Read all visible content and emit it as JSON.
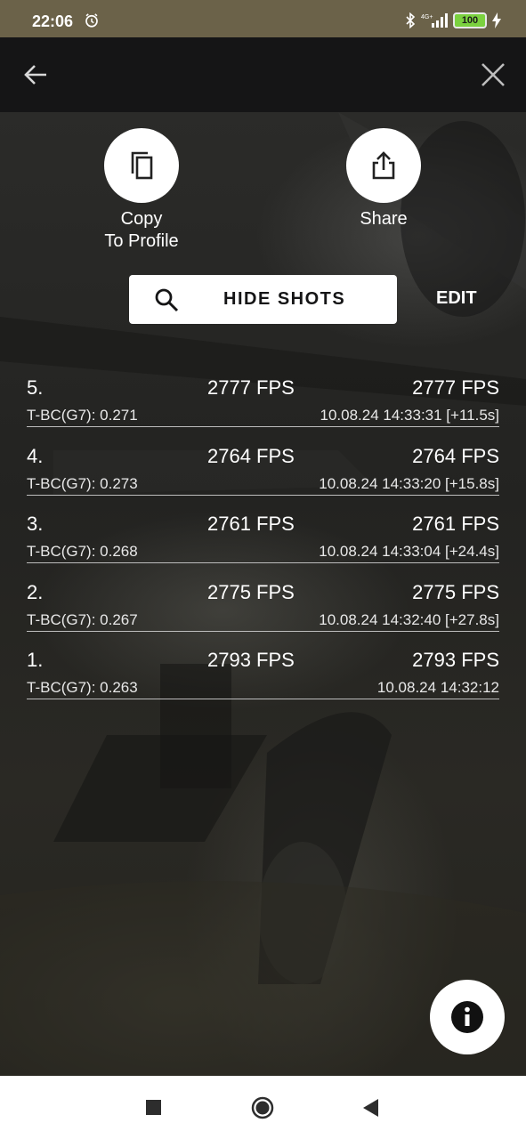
{
  "status_bar": {
    "time": "22:06",
    "battery": "100",
    "icons": [
      "alarm-icon",
      "bluetooth-icon",
      "signal-icon",
      "battery-icon",
      "charging-icon"
    ]
  },
  "app_bar": {
    "back_icon": "back-arrow-icon",
    "close_icon": "close-icon"
  },
  "actions": {
    "copy": {
      "line1": "Copy",
      "line2": "To Profile",
      "icon": "copy-icon"
    },
    "share": {
      "label": "Share",
      "icon": "share-icon"
    }
  },
  "controls": {
    "hide_shots": "HIDE SHOTS",
    "edit": "EDIT"
  },
  "shots": [
    {
      "num": "5.",
      "speed_mid": "2777 FPS",
      "speed_right": "2777 FPS",
      "bc": "T-BC(G7): 0.271",
      "time": "10.08.24 14:33:31 [+11.5s]"
    },
    {
      "num": "4.",
      "speed_mid": "2764 FPS",
      "speed_right": "2764 FPS",
      "bc": "T-BC(G7): 0.273",
      "time": "10.08.24 14:33:20 [+15.8s]"
    },
    {
      "num": "3.",
      "speed_mid": "2761 FPS",
      "speed_right": "2761 FPS",
      "bc": "T-BC(G7): 0.268",
      "time": "10.08.24 14:33:04 [+24.4s]"
    },
    {
      "num": "2.",
      "speed_mid": "2775 FPS",
      "speed_right": "2775 FPS",
      "bc": "T-BC(G7): 0.267",
      "time": "10.08.24 14:32:40 [+27.8s]"
    },
    {
      "num": "1.",
      "speed_mid": "2793 FPS",
      "speed_right": "2793 FPS",
      "bc": "T-BC(G7): 0.263",
      "time": "10.08.24 14:32:12"
    }
  ],
  "fab": {
    "icon": "info-icon"
  },
  "colors": {
    "status_bar": "#6b6249",
    "app_bar": "#151516",
    "battery": "#7bd13f",
    "accent": "#ffffff"
  }
}
